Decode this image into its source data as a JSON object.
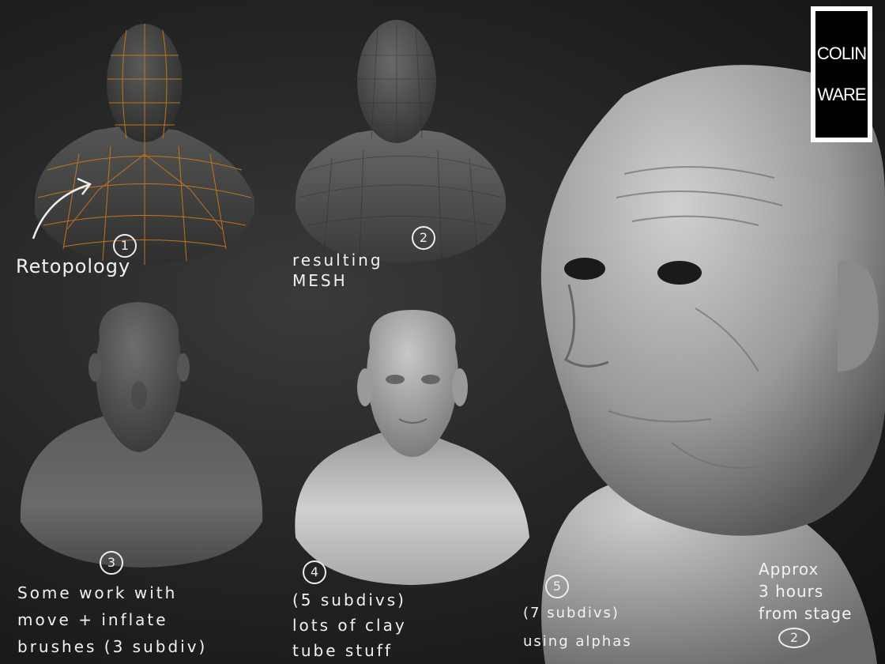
{
  "logo": {
    "line1": "COLIN",
    "line2": "WARE"
  },
  "stages": [
    {
      "number": "1",
      "caption": "Retopology"
    },
    {
      "number": "2",
      "caption": "resulting\nMESH"
    },
    {
      "number": "3",
      "caption": "Some work with\nmove + inflate\nbrushes (3 subdiv)"
    },
    {
      "number": "4",
      "caption": "(5 subdivs)\nlots of clay\ntube stuff"
    },
    {
      "number": "5",
      "caption": "(7 subdivs)\nusing alphas"
    }
  ],
  "side_note": "Approx\n3 hours\nfrom stage",
  "side_note_stage": "2",
  "colors": {
    "wireframe": "#d07a1a",
    "background": "#1e1e1e"
  }
}
